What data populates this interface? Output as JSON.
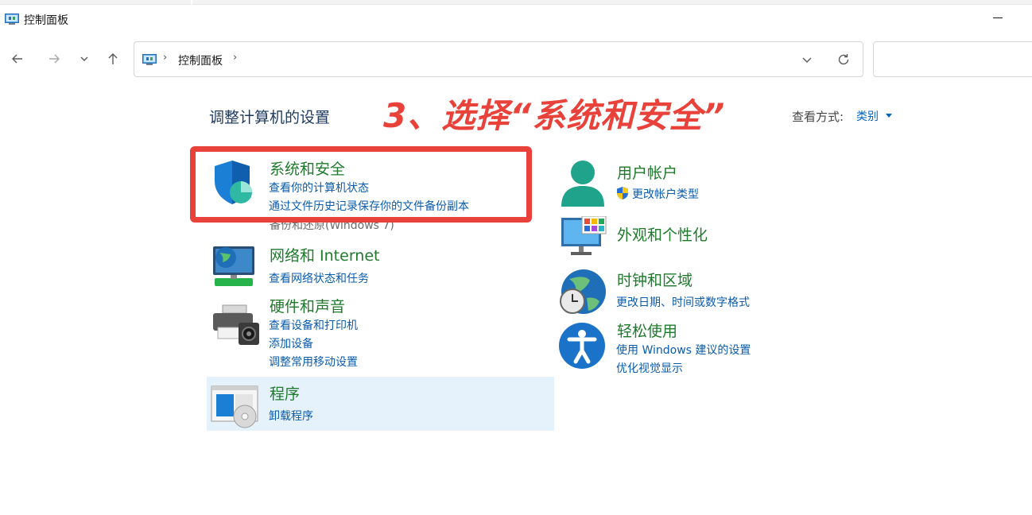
{
  "window": {
    "title": "控制面板"
  },
  "nav": {
    "back": "←",
    "forward": "→",
    "recent": "⌄",
    "up": "↑"
  },
  "address": {
    "separator": "›",
    "crumb": "控制面板",
    "search_placeholder": ""
  },
  "main": {
    "heading": "调整计算机的设置",
    "annotation": "3、选择“系统和安全”",
    "view_by_label": "查看方式:",
    "view_by_value": "类别"
  },
  "categories": {
    "system_security": {
      "title": "系统和安全",
      "links": [
        "查看你的计算机状态",
        "通过文件历史记录保存你的文件备份副本"
      ],
      "peek": "备份和还原(Windows 7)"
    },
    "network": {
      "title": "网络和 Internet",
      "links": [
        "查看网络状态和任务"
      ]
    },
    "hardware": {
      "title": "硬件和声音",
      "links": [
        "查看设备和打印机",
        "添加设备",
        "调整常用移动设置"
      ]
    },
    "programs": {
      "title": "程序",
      "links": [
        "卸载程序"
      ]
    },
    "user_accounts": {
      "title": "用户帐户",
      "links": [
        "更改帐户类型"
      ]
    },
    "appearance": {
      "title": "外观和个性化",
      "links": []
    },
    "clock_region": {
      "title": "时钟和区域",
      "links": [
        "更改日期、时间或数字格式"
      ]
    },
    "ease_access": {
      "title": "轻松使用",
      "links": [
        "使用 Windows 建议的设置",
        "优化视觉显示"
      ]
    }
  },
  "colors": {
    "annotation": "#e8423a",
    "category_title": "#1f7a2c",
    "link": "#0a5cad",
    "programs_hover": "#e5f1fb"
  }
}
